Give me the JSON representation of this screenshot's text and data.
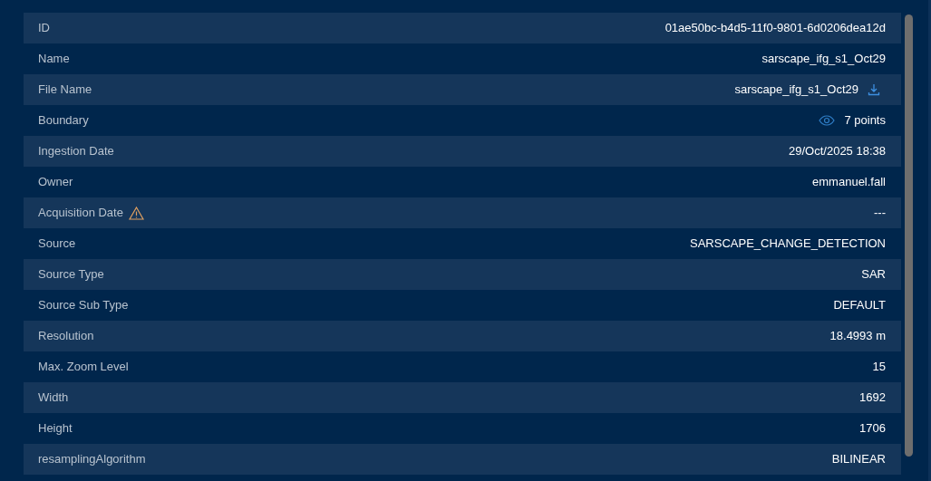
{
  "rows": [
    {
      "label": "ID",
      "value": "01ae50bc-b4d5-11f0-9801-6d0206dea12d",
      "kind": "plain"
    },
    {
      "label": "Name",
      "value": "sarscape_ifg_s1_Oct29",
      "kind": "plain"
    },
    {
      "label": "File Name",
      "value": "sarscape_ifg_s1_Oct29",
      "kind": "download"
    },
    {
      "label": "Boundary",
      "value": "7 points",
      "kind": "view"
    },
    {
      "label": "Ingestion Date",
      "value": "29/Oct/2025 18:38",
      "kind": "plain"
    },
    {
      "label": "Owner",
      "value": "emmanuel.fall",
      "kind": "plain"
    },
    {
      "label": "Acquisition Date",
      "value": "---",
      "kind": "warning"
    },
    {
      "label": "Source",
      "value": "SARSCAPE_CHANGE_DETECTION",
      "kind": "plain"
    },
    {
      "label": "Source Type",
      "value": "SAR",
      "kind": "plain"
    },
    {
      "label": "Source Sub Type",
      "value": "DEFAULT",
      "kind": "plain"
    },
    {
      "label": "Resolution",
      "value": "18.4993 m",
      "kind": "plain"
    },
    {
      "label": "Max. Zoom Level",
      "value": "15",
      "kind": "plain"
    },
    {
      "label": "Width",
      "value": "1692",
      "kind": "plain"
    },
    {
      "label": "Height",
      "value": "1706",
      "kind": "plain"
    },
    {
      "label": "resamplingAlgorithm",
      "value": "BILINEAR",
      "kind": "plain"
    }
  ]
}
